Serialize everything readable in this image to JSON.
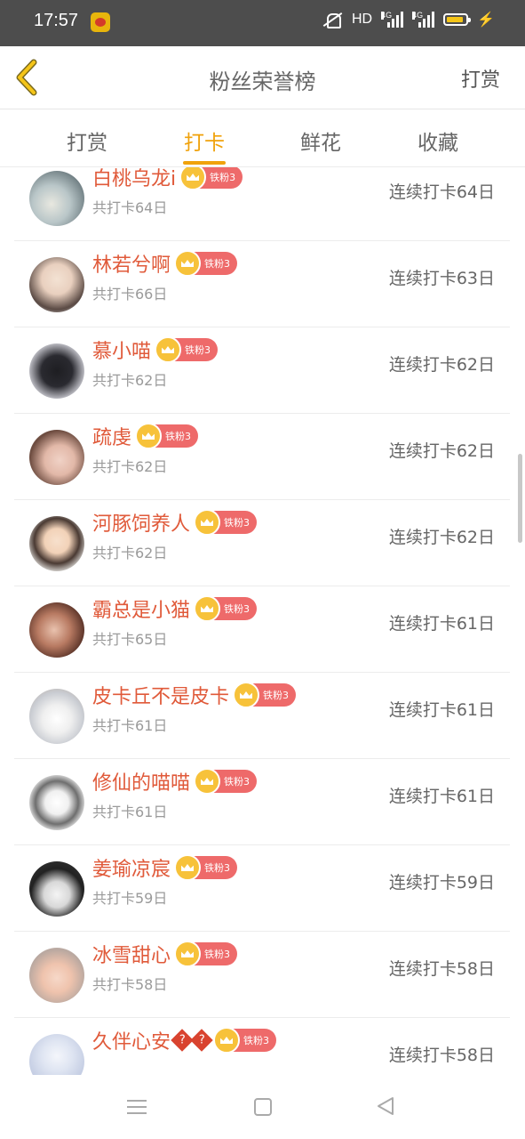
{
  "status": {
    "time": "17:57",
    "hd": "HD",
    "net1": "4G",
    "net2": "4G"
  },
  "header": {
    "title": "粉丝荣誉榜",
    "action": "打赏"
  },
  "tabs": [
    {
      "label": "打赏",
      "active": false
    },
    {
      "label": "打卡",
      "active": true
    },
    {
      "label": "鲜花",
      "active": false
    },
    {
      "label": "收藏",
      "active": false
    }
  ],
  "fans": [
    {
      "name": "白桃乌龙i",
      "badge": "铁粉3",
      "total": "共打卡64日",
      "streak": "连续打卡64日"
    },
    {
      "name": "林若兮啊",
      "badge": "铁粉3",
      "total": "共打卡66日",
      "streak": "连续打卡63日"
    },
    {
      "name": "慕小喵",
      "badge": "铁粉3",
      "total": "共打卡62日",
      "streak": "连续打卡62日"
    },
    {
      "name": "疏虔",
      "badge": "铁粉3",
      "total": "共打卡62日",
      "streak": "连续打卡62日"
    },
    {
      "name": "河豚饲养人",
      "badge": "铁粉3",
      "total": "共打卡62日",
      "streak": "连续打卡62日"
    },
    {
      "name": "霸总是小猫",
      "badge": "铁粉3",
      "total": "共打卡65日",
      "streak": "连续打卡61日"
    },
    {
      "name": "皮卡丘不是皮卡",
      "badge": "铁粉3",
      "total": "共打卡61日",
      "streak": "连续打卡61日"
    },
    {
      "name": "修仙的喵喵",
      "badge": "铁粉3",
      "total": "共打卡61日",
      "streak": "连续打卡61日"
    },
    {
      "name": "姜瑜凉宸",
      "badge": "铁粉3",
      "total": "共打卡59日",
      "streak": "连续打卡59日"
    },
    {
      "name": "冰雪甜心",
      "badge": "铁粉3",
      "total": "共打卡58日",
      "streak": "连续打卡58日"
    },
    {
      "name": "久伴心安",
      "name_suffix": "??",
      "badge": "铁粉3",
      "streak": "连续打卡58日"
    }
  ],
  "colors": {
    "accent": "#f0a20c",
    "name": "#e05a3a",
    "badge": "#ee6a6a",
    "crown": "#f7c23a"
  }
}
